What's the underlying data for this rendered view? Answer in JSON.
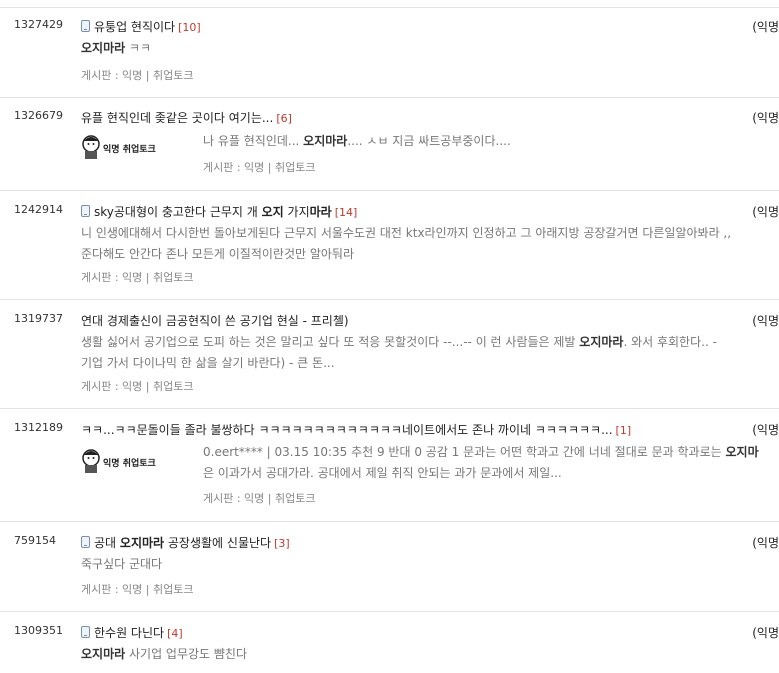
{
  "posts": [
    {
      "number": "1327429",
      "title_pre": "유퉁업 현직이다",
      "title_hl": "",
      "title_post": "",
      "comment_count": "[10]",
      "has_mobile": true,
      "right": "(익명",
      "snippet_line1_hl": "오지마라",
      "snippet_line1_rest": " ㅋㅋ",
      "meta": "게시판 : 익명 | 취업토크"
    },
    {
      "number": "1326679",
      "title_pre": "유플 현직인데 좆같은 곳이다 여기는...",
      "comment_count": "[6]",
      "has_mobile": false,
      "right": "(익명",
      "thumbnail_text": "익명 취업토크",
      "snippet_pre": "나 유플 현직인데... ",
      "snippet_hl": "오지마라",
      "snippet_post": ".... ㅅㅂ 지금 싸트공부중이다....",
      "meta": "게시판 : 익명 | 취업토크"
    },
    {
      "number": "1242914",
      "title_pre": "sky공대형이 충고한다 근무지 개 ",
      "title_hl": "오지",
      "title_mid": " 가지",
      "title_hl2": "마라",
      "comment_count": "[14]",
      "has_mobile": true,
      "right": "(익명",
      "snippet_line1": "니 인생에대해서 다시한번 돌아보게된다 근무지 서울수도권 대전 ktx라인까지 인정하고 그 아래지방 공장갈거면 다른일알아봐라 ,,",
      "snippet_line2": "준다해도 안간다 존나 모든게 이질적이란것만 알아둬라",
      "meta": "게시판 : 익명 | 취업토크"
    },
    {
      "number": "1319737",
      "title_pre": "연대 경제출신이 금공현직이 쓴 공기업 현실 - 프리첼)",
      "comment_count": "",
      "has_mobile": false,
      "right": "(익명",
      "snippet_line1_pre": "생활 싫어서 공기업으로 도피 하는 것은 말리고 싶다 또 적응 못할것이다 --...-- 이 런 사람들은 제발 ",
      "snippet_line1_hl": "오지마라",
      "snippet_line1_post": ". 와서 후회한다.. -",
      "snippet_line2": "기업 가서 다이나믹 한 삶을 살기 바란다) - 큰 돈...",
      "meta": "게시판 : 익명 | 취업토크"
    },
    {
      "number": "1312189",
      "title_pre": "ㅋㅋ...ㅋㅋ문돌이들 졸라 불쌍하다 ㅋㅋㅋㅋㅋㅋㅋㅋㅋㅋㅋㅋㅋ네이트에서도 존나 까이네 ㅋㅋㅋㅋㅋㅋ...",
      "comment_count": "[1]",
      "has_mobile": false,
      "right": "(익명",
      "thumbnail_text": "익명 취업토크",
      "snippet_line1_pre": "0.eert**** | 03.15 10:35 추천 9 반대 0 공감 1 문과는 어떤 학과고 간에 너네 절대로 문과 학과로는 ",
      "snippet_line1_hl": "오지마",
      "snippet_line2": "은 이과가서 공대가라. 공대에서 제일 취직 안되는 과가 문과에서 제일...",
      "meta": "게시판 : 익명 | 취업토크"
    },
    {
      "number": "759154",
      "title_pre": "공대 ",
      "title_hl": "오지마라",
      "title_post": " 공장생활에 신물난다",
      "comment_count": "[3]",
      "has_mobile": true,
      "right": "(익명",
      "snippet_line1": "죽구싶다 군대다",
      "meta": "게시판 : 익명 | 취업토크"
    },
    {
      "number": "1309351",
      "title_pre": "한수원 다닌다",
      "comment_count": "[4]",
      "has_mobile": true,
      "right": "(익명",
      "snippet_line1_hl": "오지마라",
      "snippet_line1_rest": " 사기업 업무강도 뺨친다"
    }
  ],
  "colors": {
    "comment_count": "#c0392b",
    "divider": "#e3e3e3",
    "snippet": "#777777"
  }
}
